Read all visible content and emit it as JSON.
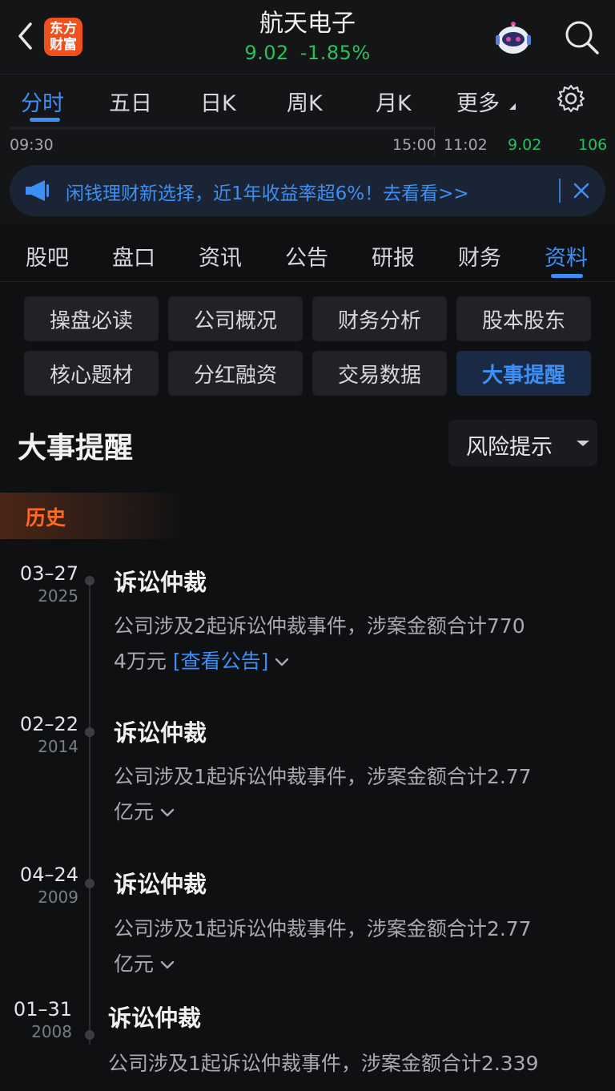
{
  "header": {
    "logo_line1": "东方",
    "logo_line2": "财富",
    "stock_name": "航天电子",
    "price": "9.02",
    "change_pct": "-1.85%"
  },
  "chart_tabs": [
    "分时",
    "五日",
    "日K",
    "周K",
    "月K",
    "更多"
  ],
  "time_strip": {
    "start": "09:30",
    "end": "15:00",
    "current_time": "11:02",
    "current_price": "9.02",
    "volume": "106"
  },
  "banner": {
    "text": "闲钱理财新选择，近1年收益率超6%！去看看>>"
  },
  "info_tabs": [
    "股吧",
    "盘口",
    "资讯",
    "公告",
    "研报",
    "财务",
    "资料"
  ],
  "sub_buttons": [
    "操盘必读",
    "公司概况",
    "财务分析",
    "股本股东",
    "核心题材",
    "分红融资",
    "交易数据",
    "大事提醒"
  ],
  "section": {
    "title": "大事提醒",
    "filter_label": "风险提示",
    "history_label": "历史"
  },
  "events": [
    {
      "date": "03–27",
      "year": "2025",
      "title": "诉讼仲裁",
      "desc_line1": "公司涉及2起诉讼仲裁事件，涉案金额合计770",
      "desc_line2": "4万元",
      "link": "[查看公告]"
    },
    {
      "date": "02–22",
      "year": "2014",
      "title": "诉讼仲裁",
      "desc_line1": "公司涉及1起诉讼仲裁事件，涉案金额合计2.77",
      "desc_line2": "亿元",
      "link": ""
    },
    {
      "date": "04–24",
      "year": "2009",
      "title": "诉讼仲裁",
      "desc_line1": "公司涉及1起诉讼仲裁事件，涉案金额合计2.77",
      "desc_line2": "亿元",
      "link": ""
    },
    {
      "date": "01–31",
      "year": "2008",
      "title": "诉讼仲裁",
      "desc_line1": "公司涉及1起诉讼仲裁事件，涉案金额合计2.339",
      "desc_line2": "",
      "link": ""
    }
  ],
  "colors": {
    "accent": "#3d8ff5",
    "down_green": "#29c05a",
    "brand_orange": "#f0501e",
    "history_orange": "#ff6a1f"
  }
}
